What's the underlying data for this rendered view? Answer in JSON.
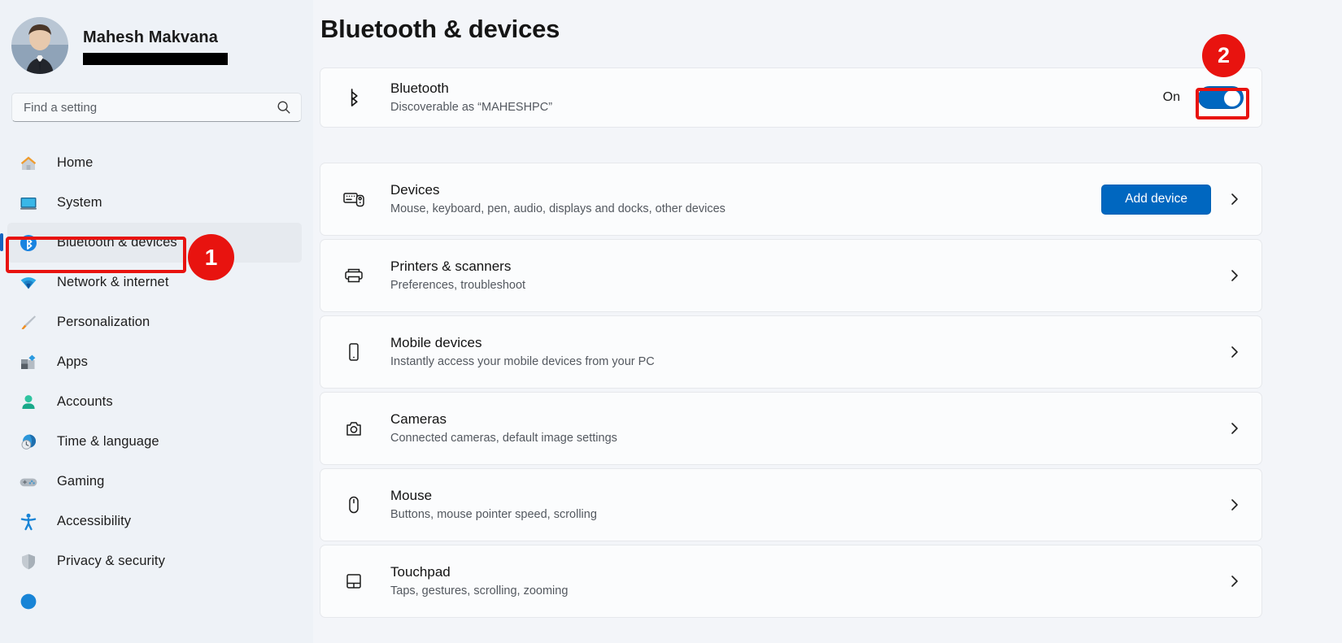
{
  "profile": {
    "name": "Mahesh Makvana",
    "email_redacted": true
  },
  "search": {
    "placeholder": "Find a setting",
    "value": ""
  },
  "sidebar": {
    "items": [
      {
        "label": "Home",
        "icon": "home-icon",
        "selected": false
      },
      {
        "label": "System",
        "icon": "system-icon",
        "selected": false
      },
      {
        "label": "Bluetooth & devices",
        "icon": "bluetooth-icon",
        "selected": true
      },
      {
        "label": "Network & internet",
        "icon": "network-icon",
        "selected": false
      },
      {
        "label": "Personalization",
        "icon": "personalization-icon",
        "selected": false
      },
      {
        "label": "Apps",
        "icon": "apps-icon",
        "selected": false
      },
      {
        "label": "Accounts",
        "icon": "accounts-icon",
        "selected": false
      },
      {
        "label": "Time & language",
        "icon": "time-language-icon",
        "selected": false
      },
      {
        "label": "Gaming",
        "icon": "gaming-icon",
        "selected": false
      },
      {
        "label": "Accessibility",
        "icon": "accessibility-icon",
        "selected": false
      },
      {
        "label": "Privacy & security",
        "icon": "privacy-security-icon",
        "selected": false
      }
    ]
  },
  "page": {
    "title": "Bluetooth & devices"
  },
  "bluetooth_card": {
    "icon": "bluetooth-icon",
    "title": "Bluetooth",
    "subtitle": "Discoverable as “MAHESHPC”",
    "toggle_state_label": "On",
    "toggle_on": true
  },
  "rows": [
    {
      "icon": "devices-icon",
      "title": "Devices",
      "subtitle": "Mouse, keyboard, pen, audio, displays and docks, other devices",
      "button": "Add device",
      "chevron": "chevron-right-icon"
    },
    {
      "icon": "printer-icon",
      "title": "Printers & scanners",
      "subtitle": "Preferences, troubleshoot",
      "button": null,
      "chevron": "chevron-right-icon"
    },
    {
      "icon": "mobile-icon",
      "title": "Mobile devices",
      "subtitle": "Instantly access your mobile devices from your PC",
      "button": null,
      "chevron": "chevron-right-icon"
    },
    {
      "icon": "camera-icon",
      "title": "Cameras",
      "subtitle": "Connected cameras, default image settings",
      "button": null,
      "chevron": "chevron-right-icon"
    },
    {
      "icon": "mouse-icon",
      "title": "Mouse",
      "subtitle": "Buttons, mouse pointer speed, scrolling",
      "button": null,
      "chevron": "chevron-right-icon"
    },
    {
      "icon": "touchpad-icon",
      "title": "Touchpad",
      "subtitle": "Taps, gestures, scrolling, zooming",
      "button": null,
      "chevron": "chevron-right-icon"
    }
  ],
  "annotations": [
    {
      "number": "1",
      "target": "sidebar-item-bluetooth-devices"
    },
    {
      "number": "2",
      "target": "bluetooth-toggle"
    }
  ],
  "colors": {
    "accent_blue": "#0067c0",
    "annotation_red": "#e8130f",
    "sidebar_bg": "#eef2f7",
    "content_bg": "#f3f5f9",
    "card_bg": "#fbfcfd"
  }
}
